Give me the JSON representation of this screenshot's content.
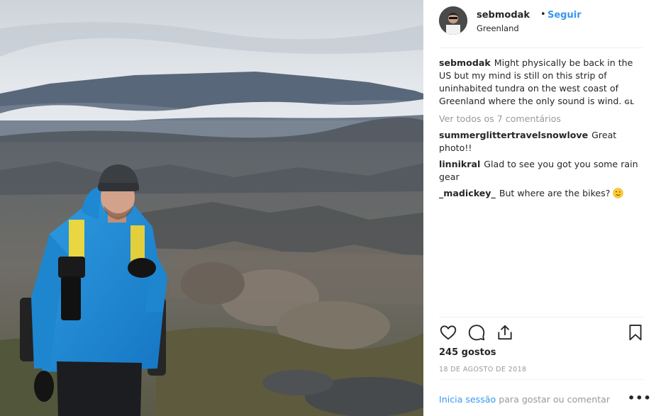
{
  "post": {
    "image_alt": "Hiker in blue jacket on tundra in Greenland"
  },
  "header": {
    "username": "sebmodak",
    "separator": "•",
    "follow_label": "Seguir",
    "location": "Greenland"
  },
  "caption": {
    "username": "sebmodak",
    "text": "Might physically be back in the US but my mind is still on this strip of uninhabited tundra on the west coast of Greenland where the only sound is wind.",
    "badge": "GL"
  },
  "view_all_comments": "Ver todos os 7 comentários",
  "comments": [
    {
      "username": "summerglittertravelsnowlove",
      "text": "Great photo!!"
    },
    {
      "username": "linnikral",
      "text": "Glad to see you got you some rain gear"
    },
    {
      "username": "_madickey_",
      "text": "But where are the bikes?"
    }
  ],
  "actions": {
    "like_icon": "heart-icon",
    "comment_icon": "comment-icon",
    "share_icon": "share-icon",
    "save_icon": "bookmark-icon"
  },
  "likes": "245 gostos",
  "date": "18 DE AGOSTO DE 2018",
  "footer": {
    "login_link": "Inicia sessão",
    "login_text": " para gostar ou comentar",
    "more_label": "•••"
  },
  "colors": {
    "link": "#3897f0",
    "text": "#262626",
    "muted": "#999999",
    "divider": "#efefef"
  }
}
